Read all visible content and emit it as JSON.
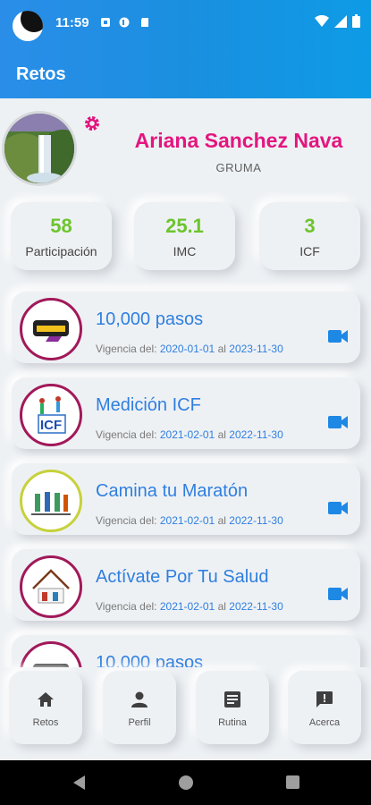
{
  "status_bar": {
    "time": "11:59"
  },
  "app_bar": {
    "title": "Retos"
  },
  "profile": {
    "name": "Ariana Sanchez Nava",
    "company": "GRUMA"
  },
  "stats": [
    {
      "value": "58",
      "label": "Participación"
    },
    {
      "value": "25.1",
      "label": "IMC"
    },
    {
      "value": "3",
      "label": "ICF"
    }
  ],
  "challenges": [
    {
      "title": "10,000 pasos",
      "prefix": "Vigencia del:",
      "start": "2020-01-01",
      "mid": "al",
      "end": "2023-11-30",
      "logo": "10000-pasos-logo"
    },
    {
      "title": "Medición ICF",
      "prefix": "Vigencia del:",
      "start": "2021-02-01",
      "mid": "al",
      "end": "2022-11-30",
      "logo": "icf-logo"
    },
    {
      "title": "Camina tu Maratón",
      "prefix": "Vigencia del:",
      "start": "2021-02-01",
      "mid": "al",
      "end": "2022-11-30",
      "logo": "camina-logo"
    },
    {
      "title": "Actívate Por Tu Salud",
      "prefix": "Vigencia del:",
      "start": "2021-02-01",
      "mid": "al",
      "end": "2022-11-30",
      "logo": "activate-logo"
    },
    {
      "title": "10,000 pasos",
      "logo": "10000-pasos-logo"
    }
  ],
  "bottom_nav": [
    {
      "label": "Retos",
      "icon": "home-icon"
    },
    {
      "label": "Perfil",
      "icon": "person-icon"
    },
    {
      "label": "Rutina",
      "icon": "article-icon"
    },
    {
      "label": "Acerca",
      "icon": "feedback-icon"
    }
  ],
  "colors": {
    "accent_pink": "#e4157f",
    "accent_blue": "#2f7fe0",
    "stat_green": "#6dc42e",
    "header_blue": "#1a8fe0"
  }
}
